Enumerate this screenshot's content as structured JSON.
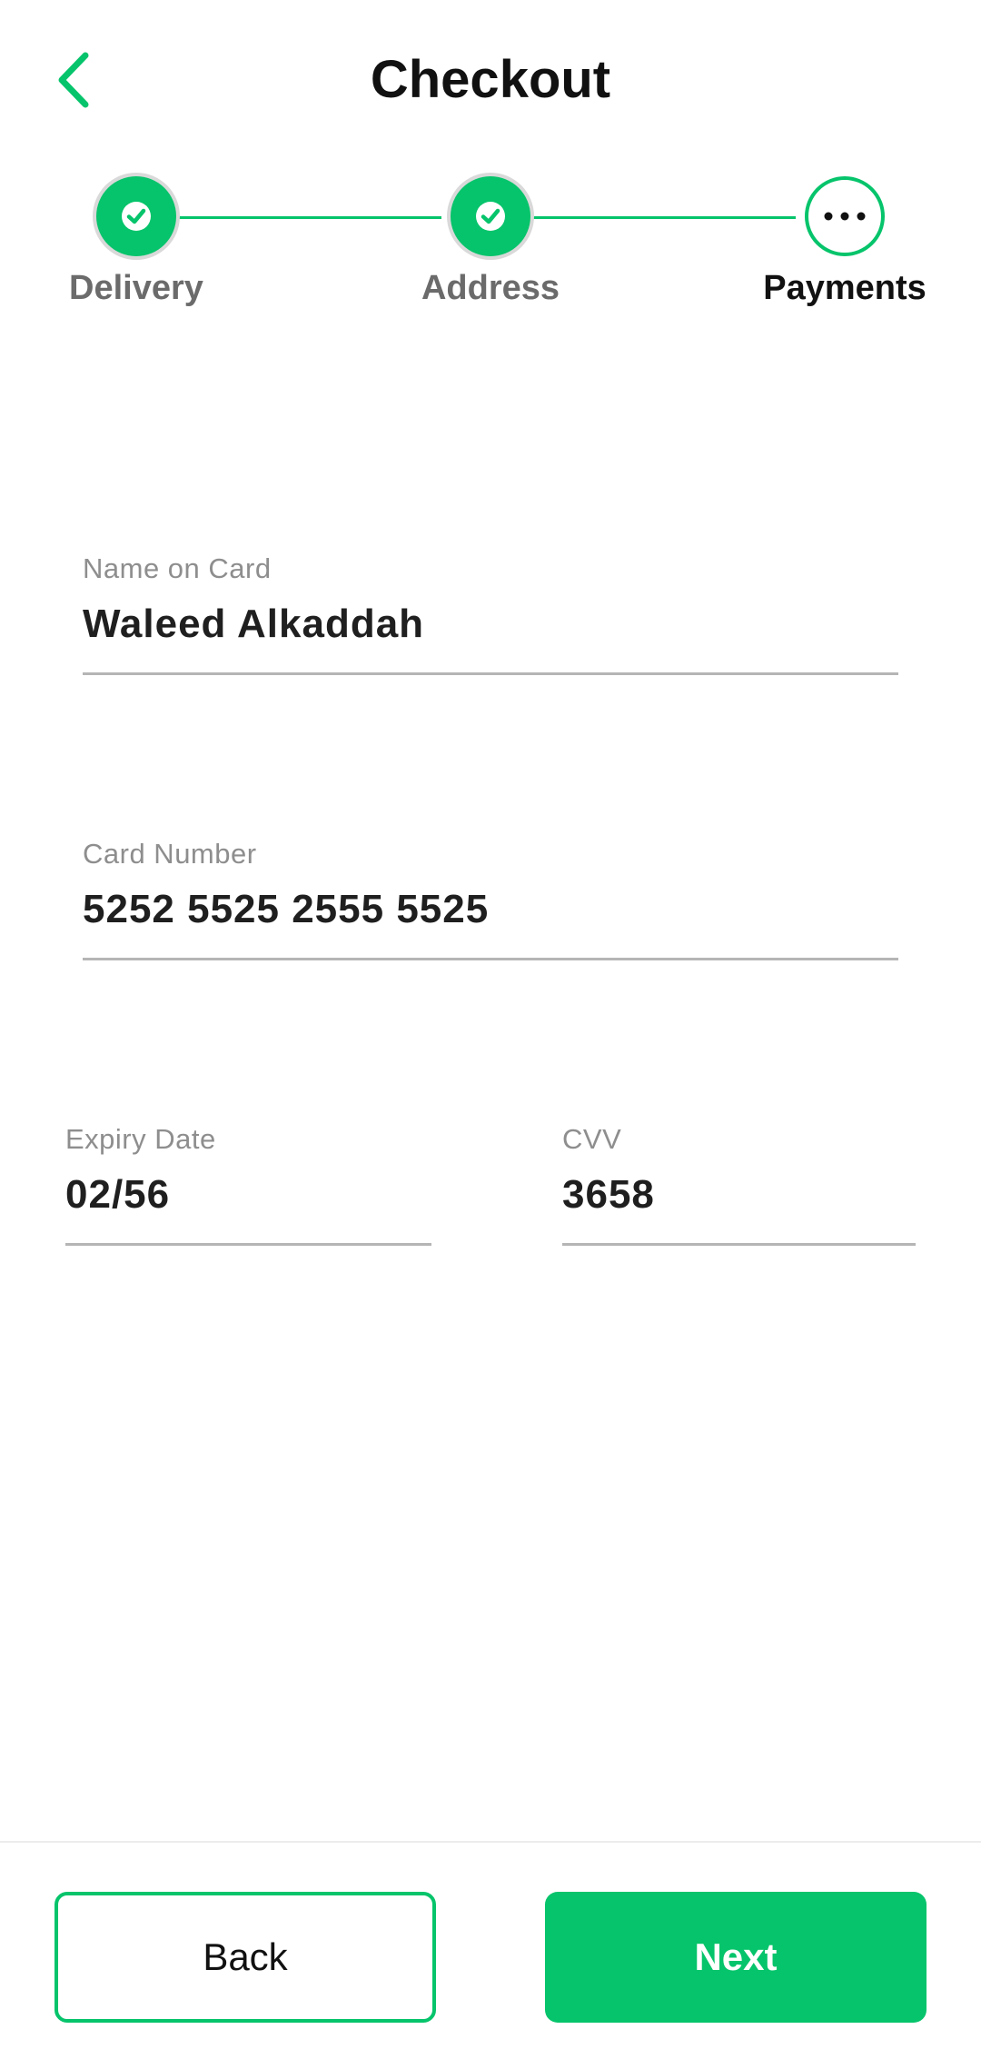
{
  "header": {
    "title": "Checkout",
    "back_icon": "chevron-left-icon"
  },
  "stepper": {
    "steps": [
      {
        "label": "Delivery",
        "status": "completed",
        "icon": "check-icon"
      },
      {
        "label": "Address",
        "status": "completed",
        "icon": "check-icon"
      },
      {
        "label": "Payments",
        "status": "current",
        "icon": "more-horizontal-icon"
      }
    ]
  },
  "form": {
    "name_on_card": {
      "label": "Name on Card",
      "value": "Waleed Alkaddah"
    },
    "card_number": {
      "label": "Card Number",
      "value": "5252 5525 2555 5525"
    },
    "expiry_date": {
      "label": "Expiry Date",
      "value": "02/56"
    },
    "cvv": {
      "label": "CVV",
      "value": "3658"
    }
  },
  "footer": {
    "back_label": "Back",
    "next_label": "Next"
  },
  "colors": {
    "accent": "#06c46b",
    "text": "#111111",
    "muted": "#8e8e8e"
  }
}
